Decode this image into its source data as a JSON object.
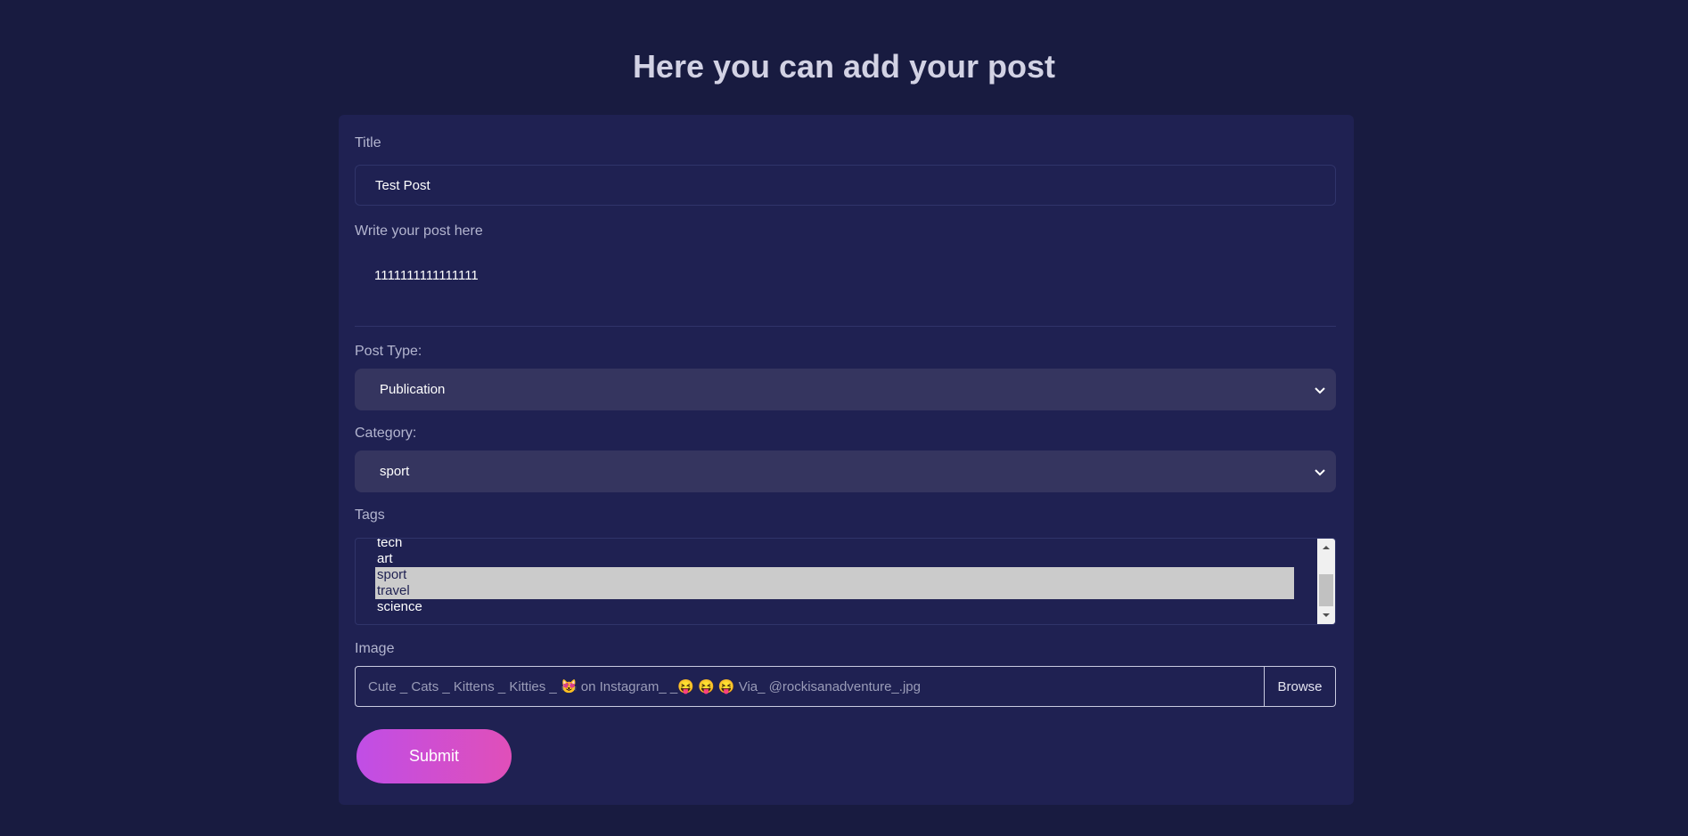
{
  "page": {
    "title": "Here you can add your post"
  },
  "form": {
    "title_label": "Title",
    "title_value": "Test Post",
    "post_label": "Write your post here",
    "post_value": "1111111111111111",
    "post_type_label": "Post Type:",
    "post_type_value": "Publication",
    "category_label": "Category:",
    "category_value": "sport",
    "tags_label": "Tags",
    "tags": [
      {
        "label": "tech",
        "selected": false
      },
      {
        "label": "art",
        "selected": false
      },
      {
        "label": "sport",
        "selected": true
      },
      {
        "label": "travel",
        "selected": true
      },
      {
        "label": "science",
        "selected": false
      }
    ],
    "image_label": "Image",
    "image_file": "Cute _ Cats _ Kittens _ Kitties _ 😻 on Instagram_ _😝 😝 😝 Via_ @rockisanadventure_.jpg",
    "browse_label": "Browse",
    "submit_label": "Submit"
  },
  "colors": {
    "background": "#181b40",
    "card": "#1f2152",
    "select_bg": "#35355f",
    "submit_gradient_start": "#c04ee6",
    "submit_gradient_end": "#e04fb9"
  }
}
